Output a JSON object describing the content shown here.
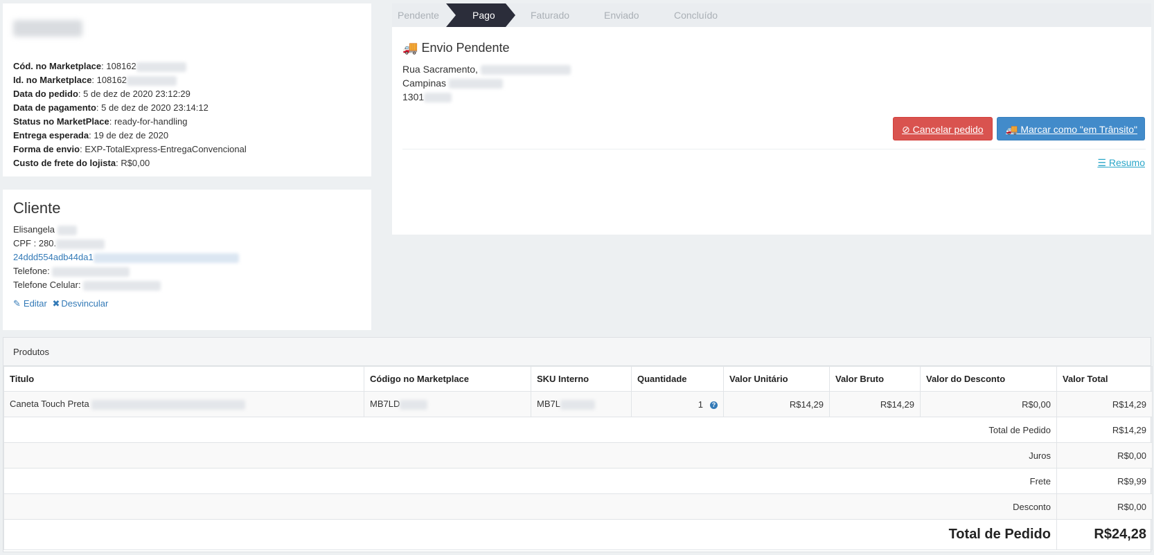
{
  "order": {
    "lines": [
      {
        "label": "Cód. no Marketplace",
        "value": "108162"
      },
      {
        "label": "Id. no Marketplace",
        "value": "108162"
      },
      {
        "label": "Data do pedido",
        "value": "5 de dez de 2020 23:12:29"
      },
      {
        "label": "Data de pagamento",
        "value": "5 de dez de 2020 23:14:12"
      },
      {
        "label": "Status no MarketPlace",
        "value": "ready-for-handling"
      },
      {
        "label": "Entrega esperada",
        "value": "19 de dez de 2020"
      },
      {
        "label": "Forma de envio",
        "value": "EXP-TotalExpress-EntregaConvencional"
      },
      {
        "label": "Custo de frete do lojista",
        "value": "R$0,00"
      }
    ]
  },
  "client": {
    "title": "Cliente",
    "name": "Elisangela",
    "cpf_label": "CPF : 280.",
    "email": "24ddd554adb44da1",
    "phone_label": "Telefone:",
    "mobile_label": "Telefone Celular:",
    "edit_label": "Editar",
    "unlink_label": "Desvincular"
  },
  "wizard": {
    "steps": [
      "Pendente",
      "Pago",
      "Faturado",
      "Enviado",
      "Concluído"
    ],
    "active_index": 1,
    "active_color": "#2b2d3a"
  },
  "shipping": {
    "title": "Envio Pendente",
    "street": "Rua Sacramento,",
    "city": "Campinas",
    "zip": "1301",
    "cancel_label": "Cancelar pedido",
    "transit_label": "Marcar como \"em Trânsito\"",
    "summary_label": "Resumo"
  },
  "products": {
    "title": "Produtos",
    "columns": [
      "Titulo",
      "Código no Marketplace",
      "SKU Interno",
      "Quantidade",
      "Valor Unitário",
      "Valor Bruto",
      "Valor do Desconto",
      "Valor Total"
    ],
    "rows": [
      {
        "title": "Caneta Touch Preta",
        "code": "MB7LD",
        "sku": "MB7L",
        "qty": "1",
        "unit": "R$14,29",
        "gross": "R$14,29",
        "discount": "R$0,00",
        "total": "R$14,29"
      }
    ],
    "summary": [
      {
        "label": "Total de Pedido",
        "value": "R$14,29"
      },
      {
        "label": "Juros",
        "value": "R$0,00"
      },
      {
        "label": "Frete",
        "value": "R$9,99"
      },
      {
        "label": "Desconto",
        "value": "R$0,00"
      }
    ],
    "grand_total_label": "Total de Pedido",
    "grand_total_value": "R$24,28"
  }
}
